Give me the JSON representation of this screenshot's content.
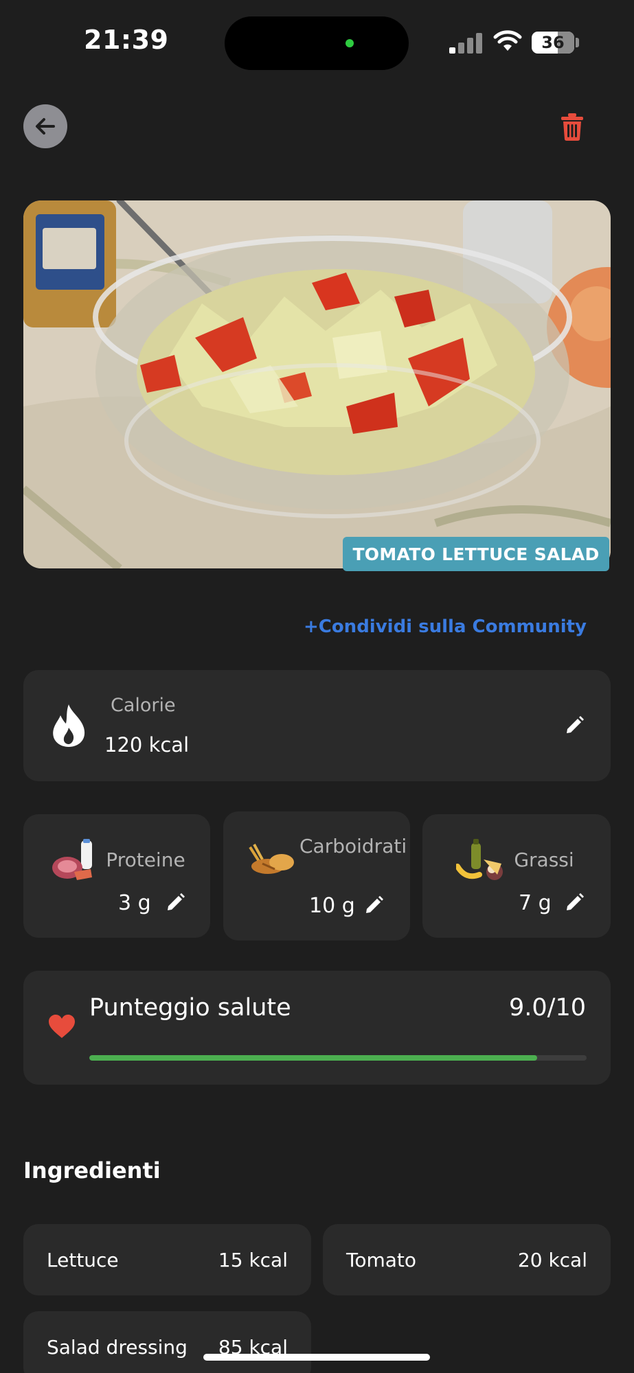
{
  "status_bar": {
    "time": "21:39",
    "battery": "36"
  },
  "meal": {
    "title": "TOMATO LETTUCE SALAD"
  },
  "share_label": "+Condividi sulla Community",
  "calories": {
    "label": "Calorie",
    "value": "120 kcal",
    "icon": "flame-icon"
  },
  "macros": [
    {
      "label": "Proteine",
      "value": "3 g",
      "icon": "protein-food-icon"
    },
    {
      "label": "Carboidrati",
      "value": "10 g",
      "icon": "bread-icon"
    },
    {
      "label": "Grassi",
      "value": "7 g",
      "icon": "fats-food-icon"
    }
  ],
  "health": {
    "label": "Punteggio salute",
    "score": "9.0/10",
    "progress": 0.9,
    "icon": "heart-icon"
  },
  "ingredients_title": "Ingredienti",
  "ingredients": [
    {
      "name": "Lettuce",
      "kcal": "15 kcal"
    },
    {
      "name": "Tomato",
      "kcal": "20 kcal"
    },
    {
      "name": "Salad dressing",
      "kcal": "85 kcal"
    }
  ],
  "colors": {
    "background": "#1e1e1e",
    "card": "#2a2a2a",
    "accent_blue": "#3a7be0",
    "delete_red": "#e74c3c",
    "health_green": "#4caf50",
    "tag_teal": "#4a9fb5"
  }
}
